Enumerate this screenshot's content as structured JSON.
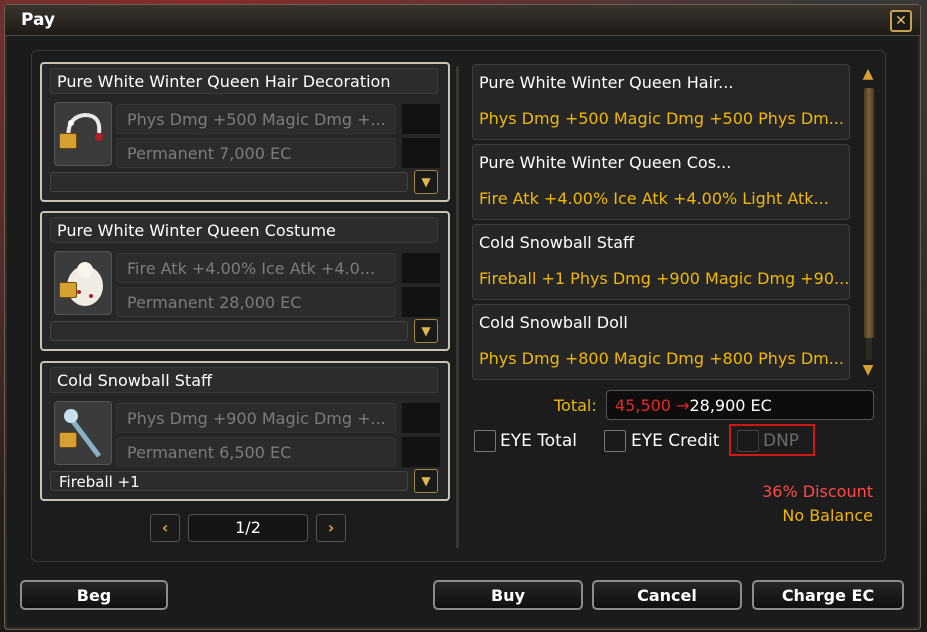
{
  "window": {
    "title": "Pay",
    "close_icon": "close-icon"
  },
  "items": [
    {
      "name": "Pure White Winter Queen Hair Decoration",
      "stat": "Phys Dmg +500 Magic Dmg +...",
      "price": "Permanent 7,000 EC",
      "option": "",
      "icon": "hair-decoration-icon"
    },
    {
      "name": "Pure White Winter Queen Costume",
      "stat": "Fire Atk +4.00% Ice Atk +4.0...",
      "price": "Permanent 28,000 EC",
      "option": "",
      "icon": "costume-icon"
    },
    {
      "name": "Cold Snowball Staff",
      "stat": "Phys Dmg +900 Magic Dmg +...",
      "price": "Permanent 6,500 EC",
      "option": "Fireball +1",
      "icon": "staff-icon"
    }
  ],
  "pagination": {
    "label": "1/2"
  },
  "summary": [
    {
      "name": "Pure White Winter Queen Hair...",
      "stat": "Phys Dmg +500 Magic Dmg +500 Phys Dm..."
    },
    {
      "name": "Pure White Winter Queen Cos...",
      "stat": "Fire Atk +4.00% Ice Atk +4.00% Light Atk..."
    },
    {
      "name": "Cold Snowball Staff",
      "stat": "Fireball +1 Phys Dmg +900 Magic Dmg +90..."
    },
    {
      "name": "Cold Snowball Doll",
      "stat": "Phys Dmg +800 Magic Dmg +800 Phys Dm..."
    }
  ],
  "total": {
    "label": "Total:",
    "old_price": "45,500",
    "arrow": "→",
    "new_price": "28,900 EC"
  },
  "checks": {
    "eye_total": "EYE Total",
    "eye_credit": "EYE Credit",
    "dnp": "DNP"
  },
  "discount": "36% Discount",
  "balance": "No Balance",
  "buttons": {
    "beg": "Beg",
    "buy": "Buy",
    "cancel": "Cancel",
    "charge": "Charge EC"
  },
  "colors": {
    "gold": "#f0b800",
    "red": "#e82828",
    "frame": "#c9c4b2"
  }
}
